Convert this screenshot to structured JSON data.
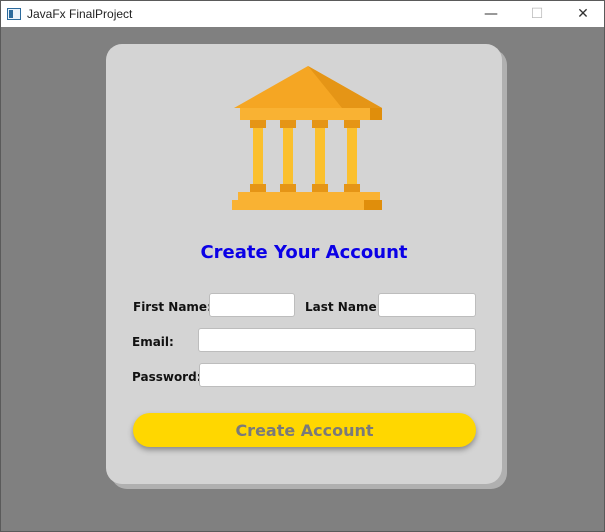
{
  "window": {
    "title": "JavaFx FinalProject",
    "controls": {
      "minimize": "—",
      "maximize": "☐",
      "close": "✕"
    }
  },
  "logo": {
    "icon": "bank-building-icon",
    "colors": {
      "roof": "#f5a623",
      "columns": "#fbc02d",
      "shadow": "#e08e0b",
      "base": "#f9b233"
    }
  },
  "form": {
    "heading": "Create Your Account",
    "first_name_label": "First Name:",
    "last_name_label": "Last Name:",
    "email_label": "Email:",
    "password_label": "Password:",
    "first_name_value": "",
    "last_name_value": "",
    "email_value": "",
    "password_value": "",
    "submit_label": "Create Account"
  },
  "colors": {
    "heading": "#0b00e6",
    "button": "#ffd700",
    "button_text": "#7a7a7a",
    "card": "#d4d4d4",
    "background": "#808080"
  }
}
